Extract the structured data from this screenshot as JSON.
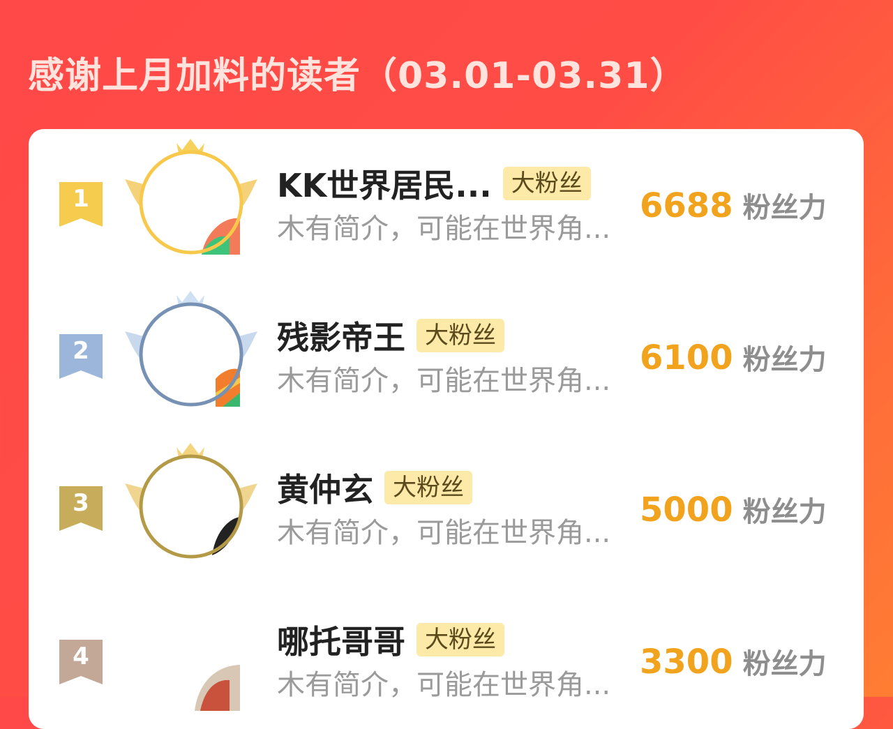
{
  "header": {
    "title": "感谢上月加料的读者（03.01-03.31）"
  },
  "readers": [
    {
      "rank": "1",
      "name": "KK世界居民...",
      "tag": "大粉丝",
      "desc": "木有简介，可能在世界角...",
      "score": "6688",
      "unit": "粉丝力",
      "colors": {
        "badge": "#f6cc4f",
        "frame": "#f7c84a",
        "wing": "#f5d27a"
      }
    },
    {
      "rank": "2",
      "name": "残影帝王",
      "tag": "大粉丝",
      "desc": "木有简介，可能在世界角...",
      "score": "6100",
      "unit": "粉丝力",
      "colors": {
        "badge": "#9bb6da",
        "frame": "#7691b4",
        "wing": "#c8d9ee"
      }
    },
    {
      "rank": "3",
      "name": "黄仲玄",
      "tag": "大粉丝",
      "desc": "木有简介，可能在世界角...",
      "score": "5000",
      "unit": "粉丝力",
      "colors": {
        "badge": "#c7ad5b",
        "frame": "#b49a46",
        "wing": "#efd58f"
      }
    },
    {
      "rank": "4",
      "name": "哪托哥哥",
      "tag": "大粉丝",
      "desc": "木有简介，可能在世界角...",
      "score": "3300",
      "unit": "粉丝力",
      "colors": {
        "badge": "#c3a898",
        "frame": "",
        "wing": ""
      }
    }
  ]
}
